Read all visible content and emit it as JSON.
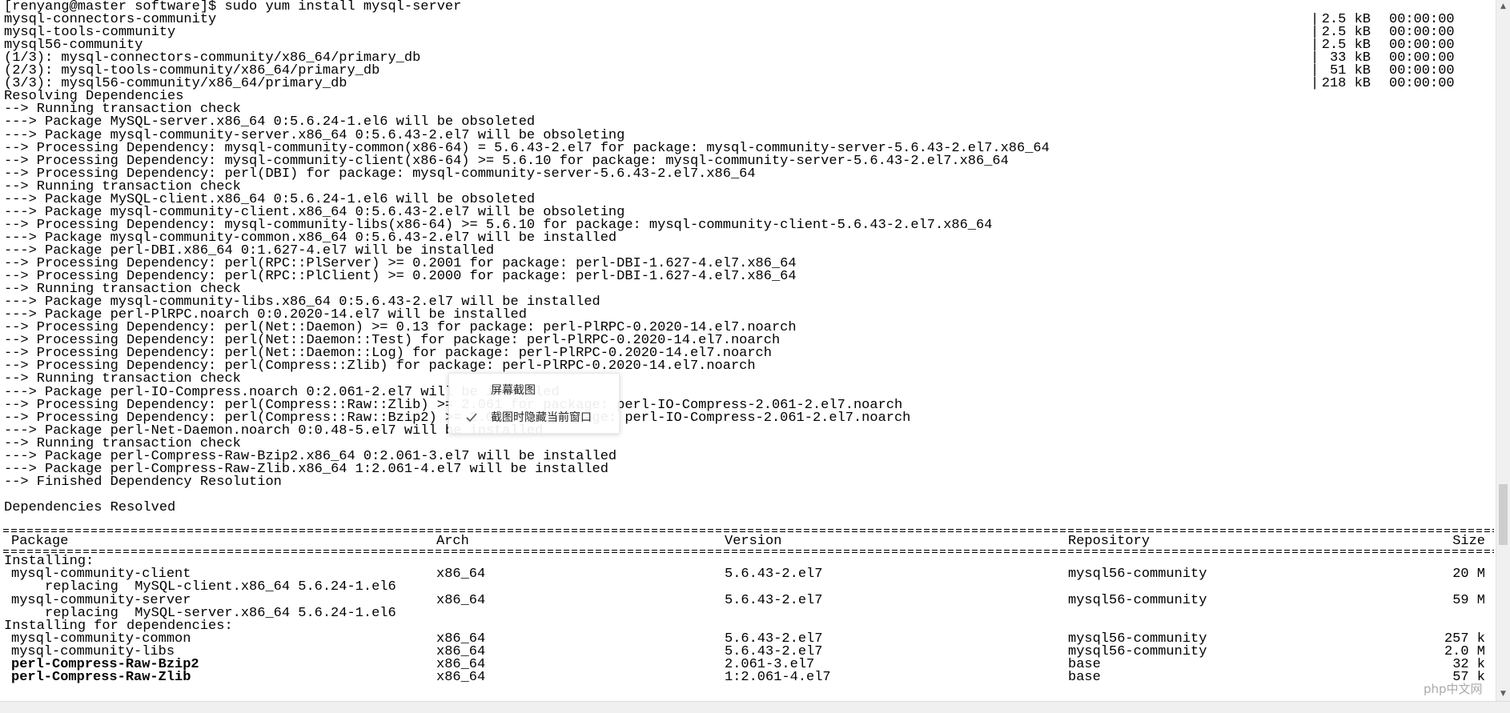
{
  "terminal": {
    "repo_lines": [
      {
        "text": "[renyang@master software]$ sudo yum install mysql-server",
        "size": "",
        "time": ""
      },
      {
        "text": "mysql-connectors-community",
        "size": "2.5 kB",
        "time": "00:00:00"
      },
      {
        "text": "mysql-tools-community",
        "size": "2.5 kB",
        "time": "00:00:00"
      },
      {
        "text": "mysql56-community",
        "size": "2.5 kB",
        "time": "00:00:00"
      },
      {
        "text": "(1/3): mysql-connectors-community/x86_64/primary_db",
        "size": "33 kB",
        "time": "00:00:00"
      },
      {
        "text": "(2/3): mysql-tools-community/x86_64/primary_db",
        "size": "51 kB",
        "time": "00:00:00"
      },
      {
        "text": "(3/3): mysql56-community/x86_64/primary_db",
        "size": "218 kB",
        "time": "00:00:00"
      }
    ],
    "lines": [
      "Resolving Dependencies",
      "--> Running transaction check",
      "---> Package MySQL-server.x86_64 0:5.6.24-1.el6 will be obsoleted",
      "---> Package mysql-community-server.x86_64 0:5.6.43-2.el7 will be obsoleting",
      "--> Processing Dependency: mysql-community-common(x86-64) = 5.6.43-2.el7 for package: mysql-community-server-5.6.43-2.el7.x86_64",
      "--> Processing Dependency: mysql-community-client(x86-64) >= 5.6.10 for package: mysql-community-server-5.6.43-2.el7.x86_64",
      "--> Processing Dependency: perl(DBI) for package: mysql-community-server-5.6.43-2.el7.x86_64",
      "--> Running transaction check",
      "---> Package MySQL-client.x86_64 0:5.6.24-1.el6 will be obsoleted",
      "---> Package mysql-community-client.x86_64 0:5.6.43-2.el7 will be obsoleting",
      "--> Processing Dependency: mysql-community-libs(x86-64) >= 5.6.10 for package: mysql-community-client-5.6.43-2.el7.x86_64",
      "---> Package mysql-community-common.x86_64 0:5.6.43-2.el7 will be installed",
      "---> Package perl-DBI.x86_64 0:1.627-4.el7 will be installed",
      "--> Processing Dependency: perl(RPC::PlServer) >= 0.2001 for package: perl-DBI-1.627-4.el7.x86_64",
      "--> Processing Dependency: perl(RPC::PlClient) >= 0.2000 for package: perl-DBI-1.627-4.el7.x86_64",
      "--> Running transaction check",
      "---> Package mysql-community-libs.x86_64 0:5.6.43-2.el7 will be installed",
      "---> Package perl-PlRPC.noarch 0:0.2020-14.el7 will be installed",
      "--> Processing Dependency: perl(Net::Daemon) >= 0.13 for package: perl-PlRPC-0.2020-14.el7.noarch",
      "--> Processing Dependency: perl(Net::Daemon::Test) for package: perl-PlRPC-0.2020-14.el7.noarch",
      "--> Processing Dependency: perl(Net::Daemon::Log) for package: perl-PlRPC-0.2020-14.el7.noarch",
      "--> Processing Dependency: perl(Compress::Zlib) for package: perl-PlRPC-0.2020-14.el7.noarch",
      "--> Running transaction check",
      "---> Package perl-IO-Compress.noarch 0:2.061-2.el7 will be installed",
      "--> Processing Dependency: perl(Compress::Raw::Zlib) >= 2.061 for package: perl-IO-Compress-2.061-2.el7.noarch",
      "--> Processing Dependency: perl(Compress::Raw::Bzip2) >= 2.061 for package: perl-IO-Compress-2.061-2.el7.noarch",
      "---> Package perl-Net-Daemon.noarch 0:0.48-5.el7 will be installed",
      "--> Running transaction check",
      "---> Package perl-Compress-Raw-Bzip2.x86_64 0:2.061-3.el7 will be installed",
      "---> Package perl-Compress-Raw-Zlib.x86_64 1:2.061-4.el7 will be installed",
      "--> Finished Dependency Resolution",
      "",
      "Dependencies Resolved"
    ],
    "table": {
      "headers": {
        "package": "Package",
        "arch": "Arch",
        "version": "Version",
        "repository": "Repository",
        "size": "Size"
      },
      "rows": [
        {
          "type": "group",
          "package": "Installing:"
        },
        {
          "type": "pkg",
          "package": "mysql-community-client",
          "arch": "x86_64",
          "version": "5.6.43-2.el7",
          "repository": "mysql56-community",
          "size": "20 M",
          "bold": false
        },
        {
          "type": "replace",
          "package": "replacing  MySQL-client.x86_64 5.6.24-1.el6"
        },
        {
          "type": "pkg",
          "package": "mysql-community-server",
          "arch": "x86_64",
          "version": "5.6.43-2.el7",
          "repository": "mysql56-community",
          "size": "59 M",
          "bold": false
        },
        {
          "type": "replace",
          "package": "replacing  MySQL-server.x86_64 5.6.24-1.el6"
        },
        {
          "type": "group",
          "package": "Installing for dependencies:"
        },
        {
          "type": "pkg",
          "package": "mysql-community-common",
          "arch": "x86_64",
          "version": "5.6.43-2.el7",
          "repository": "mysql56-community",
          "size": "257 k",
          "bold": false
        },
        {
          "type": "pkg",
          "package": "mysql-community-libs",
          "arch": "x86_64",
          "version": "5.6.43-2.el7",
          "repository": "mysql56-community",
          "size": "2.0 M",
          "bold": false
        },
        {
          "type": "pkg",
          "package": "perl-Compress-Raw-Bzip2",
          "arch": "x86_64",
          "version": "2.061-3.el7",
          "repository": "base",
          "size": "32 k",
          "bold": true
        },
        {
          "type": "pkg",
          "package": "perl-Compress-Raw-Zlib",
          "arch": "x86_64",
          "version": "1:2.061-4.el7",
          "repository": "base",
          "size": "57 k",
          "bold": true
        }
      ]
    }
  },
  "context_menu": {
    "items": [
      {
        "label": "屏幕截图",
        "checked": false
      },
      {
        "label": "截图时隐藏当前窗口",
        "checked": true
      }
    ]
  },
  "watermark": {
    "text": "php中文网"
  },
  "scrollbar": {
    "up_icon": "triangle-up-icon",
    "down_icon": "triangle-down-icon"
  }
}
